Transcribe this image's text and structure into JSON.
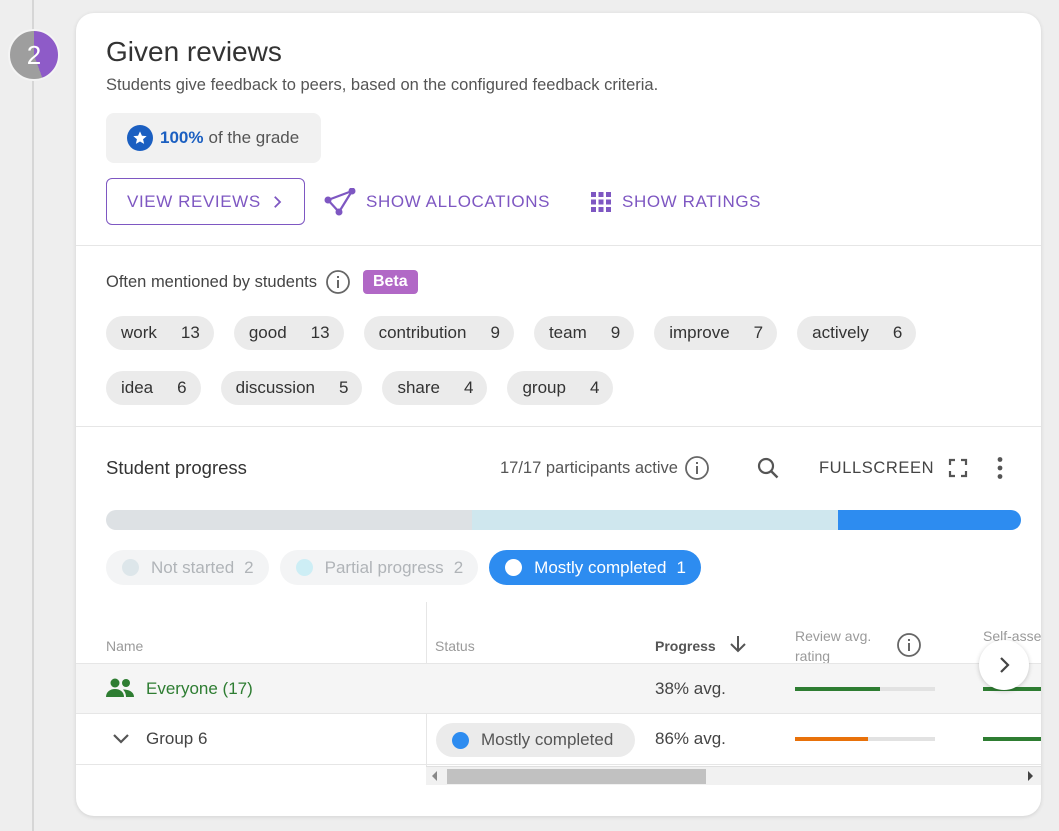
{
  "step": {
    "number": "2"
  },
  "section": {
    "title": "Given reviews",
    "subtitle": "Students give feedback to peers, based on the configured feedback criteria.",
    "grade_pct": "100%",
    "grade_suffix": "of the grade",
    "buttons": {
      "view_reviews": "VIEW REVIEWS",
      "show_allocations": "SHOW ALLOCATIONS",
      "show_ratings": "SHOW RATINGS"
    }
  },
  "mentioned": {
    "label": "Often mentioned by students",
    "badge": "Beta",
    "tags_row1": [
      {
        "word": "work",
        "count": "13"
      },
      {
        "word": "good",
        "count": "13"
      },
      {
        "word": "contribution",
        "count": "9"
      },
      {
        "word": "team",
        "count": "9"
      },
      {
        "word": "improve",
        "count": "7"
      },
      {
        "word": "actively",
        "count": "6"
      }
    ],
    "tags_row2": [
      {
        "word": "idea",
        "count": "6"
      },
      {
        "word": "discussion",
        "count": "5"
      },
      {
        "word": "share",
        "count": "4"
      },
      {
        "word": "group",
        "count": "4"
      }
    ]
  },
  "progress": {
    "title": "Student progress",
    "active": "17/17 participants active",
    "fullscreen": "FULLSCREEN",
    "bar_fractions": [
      0.4,
      0.4,
      0.2
    ],
    "colors": {
      "not_started": "#dde1e4",
      "partial": "#cfe7ee",
      "mostly": "#2d8cf0"
    },
    "filters": [
      {
        "label": "Not started",
        "count": "2",
        "active": false
      },
      {
        "label": "Partial progress",
        "count": "2",
        "active": false
      },
      {
        "label": "Mostly completed",
        "count": "1",
        "active": true
      }
    ]
  },
  "table": {
    "headers": {
      "name": "Name",
      "status": "Status",
      "progress": "Progress",
      "review_avg_1": "Review avg.",
      "review_avg_2": "rating",
      "self_1": "Self-asse",
      "self_2": "rating"
    },
    "rows": [
      {
        "name": "Everyone (17)",
        "status": "",
        "progress": "38% avg.",
        "review_fill": 0.61,
        "review_color": "#2e7d32",
        "self_color": "#2e7d32"
      },
      {
        "name": "Group 6",
        "status": "Mostly completed",
        "progress": "86% avg.",
        "review_fill": 0.52,
        "review_color": "#e8710a",
        "self_color": "#2e7d32"
      }
    ]
  }
}
